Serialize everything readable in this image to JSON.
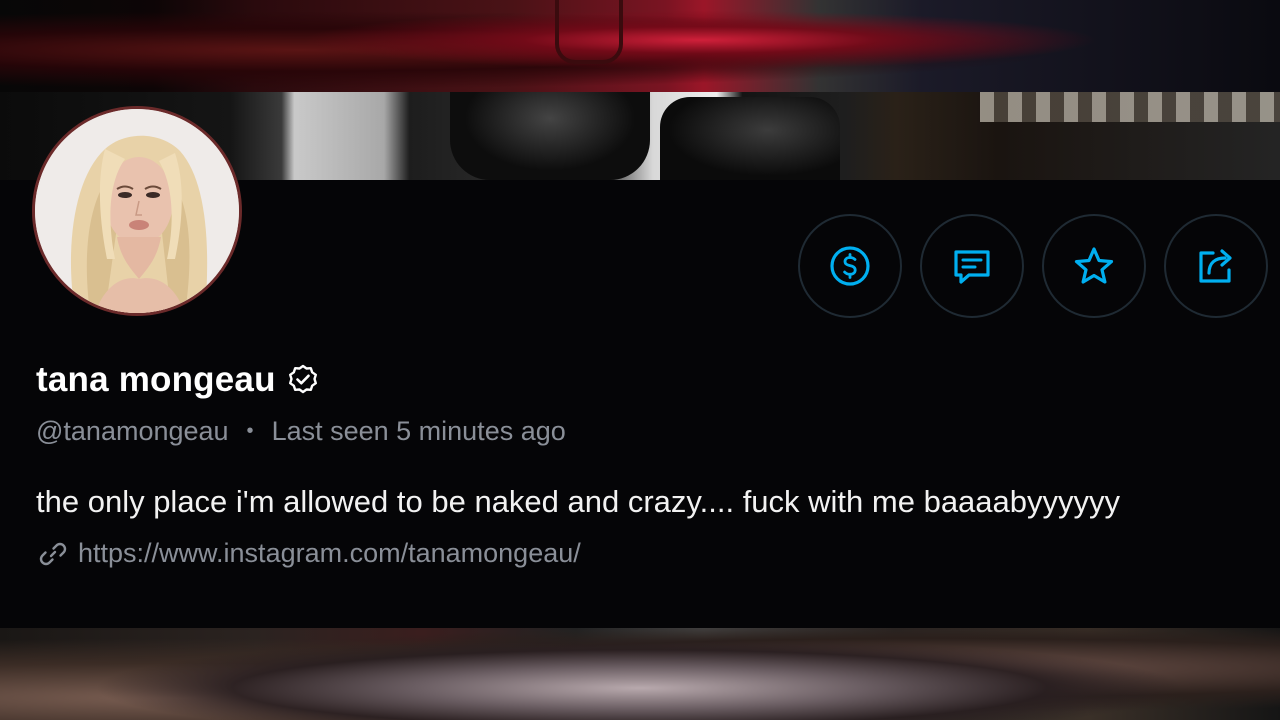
{
  "profile": {
    "display_name": "tana mongeau",
    "username": "@tanamongeau",
    "separator": "•",
    "last_seen": "Last seen 5 minutes ago",
    "bio": "the only place i'm allowed to be naked and crazy.... fuck with me baaaabyyyyyy",
    "link": "https://www.instagram.com/tanamongeau/",
    "verified_icon": "verified-badge-icon"
  },
  "actions": [
    {
      "name": "tip",
      "icon": "dollar-icon"
    },
    {
      "name": "message",
      "icon": "message-icon"
    },
    {
      "name": "favorite",
      "icon": "star-icon"
    },
    {
      "name": "share",
      "icon": "share-icon"
    }
  ],
  "colors": {
    "accent": "#00aff0",
    "background": "#050507",
    "muted_text": "#8a8f98",
    "avatar_ring": "#6b2a2a"
  }
}
